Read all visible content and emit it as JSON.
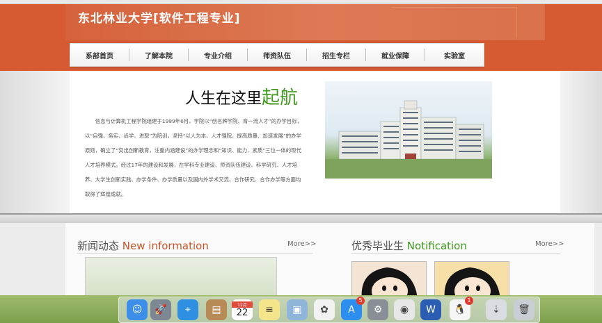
{
  "header": {
    "title": "东北林业大学[软件工程专业]"
  },
  "nav": {
    "items": [
      {
        "label": "系部首页"
      },
      {
        "label": "了解本院"
      },
      {
        "label": "专业介绍"
      },
      {
        "label": "师资队伍"
      },
      {
        "label": "招生专栏"
      },
      {
        "label": "就业保障"
      },
      {
        "label": "实验室"
      }
    ]
  },
  "hero": {
    "slogan_main": "人生在这里",
    "slogan_accent": "起航",
    "intro": "信息与计算机工程学院组建于1999年6月，学院以“创名牌学院、育一流人才”的办学目标，以“自强、务实、尚学、进取”为院训，坚持“以人为本、人才强院、提高质量、加速发展”的办学原则，确立了“突出创新教育，注重内涵建设”的办学理念和“知识、能力、素质”三位一体的现代人才培养模式。经过17年的建设和发展，在学科专业建设、师资队伍建设、科学研究、人才培养、大学生创新实践、办学条件、办学质量以及国内外学术交流、合作研究、合作办学等方面均取得了辉煌成就。"
  },
  "news": {
    "title_cn": "新闻动态",
    "title_en": "New information",
    "more": "More>>"
  },
  "graduates": {
    "title_cn": "优秀毕业生",
    "title_en": "Notification",
    "more": "More>>"
  },
  "dock": {
    "icons": [
      {
        "name": "finder-icon",
        "color": "#3d8ee8",
        "glyph": "☺"
      },
      {
        "name": "launchpad-icon",
        "color": "#7d8794",
        "glyph": "🚀"
      },
      {
        "name": "safari-icon",
        "color": "#2f8fe0",
        "glyph": "⌖"
      },
      {
        "name": "contacts-icon",
        "color": "#b88a56",
        "glyph": "▤"
      },
      {
        "name": "calendar-icon",
        "color": "#ffffff",
        "glyph": "22",
        "label_top": "12月"
      },
      {
        "name": "notes-icon",
        "color": "#f4e58b",
        "glyph": "≡"
      },
      {
        "name": "preview-icon",
        "color": "#8fb5d8",
        "glyph": "▣"
      },
      {
        "name": "photos-icon",
        "color": "#f2f2f2",
        "glyph": "✿"
      },
      {
        "name": "app-store-icon",
        "color": "#2c8ff0",
        "glyph": "A",
        "badge": "5"
      },
      {
        "name": "system-preferences-icon",
        "color": "#8a8f97",
        "glyph": "⚙"
      },
      {
        "name": "chrome-icon",
        "color": "#e7e7e7",
        "glyph": "◉"
      },
      {
        "name": "word-icon",
        "color": "#2b5eb3",
        "glyph": "W"
      },
      {
        "name": "qq-icon",
        "color": "#f5f5f5",
        "glyph": "🐧",
        "badge": "1"
      },
      {
        "name": "downloads-icon",
        "color": "#d9dde2",
        "glyph": "⇣"
      },
      {
        "name": "trash-icon",
        "color": "#c9ced4",
        "glyph": "🗑"
      }
    ]
  }
}
